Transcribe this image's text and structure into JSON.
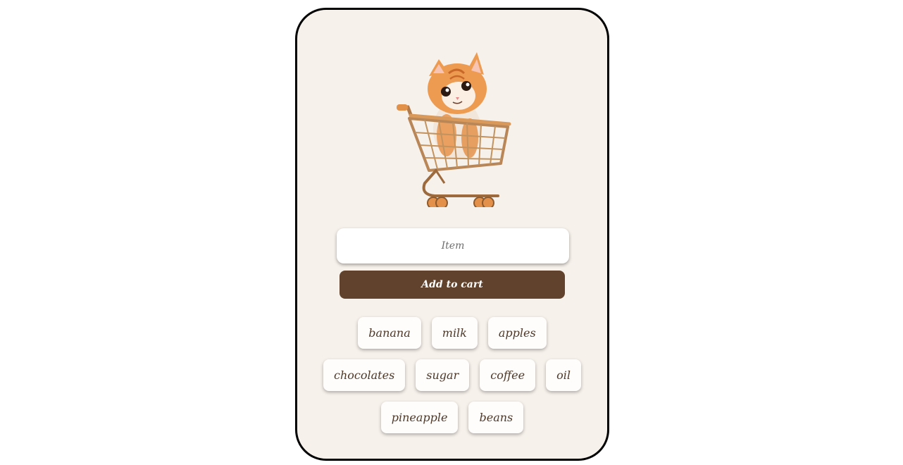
{
  "app": {
    "hero_image": "kitten-in-shopping-cart",
    "accent_color": "#61432d",
    "card_background": "#f7f1eb"
  },
  "form": {
    "item_placeholder": "Item",
    "item_value": "",
    "add_button_label": "Add to cart"
  },
  "cart": {
    "rows": [
      [
        "banana",
        "milk",
        "apples"
      ],
      [
        "chocolates",
        "sugar",
        "coffee",
        "oil"
      ],
      [
        "pineapple",
        "beans"
      ]
    ]
  }
}
